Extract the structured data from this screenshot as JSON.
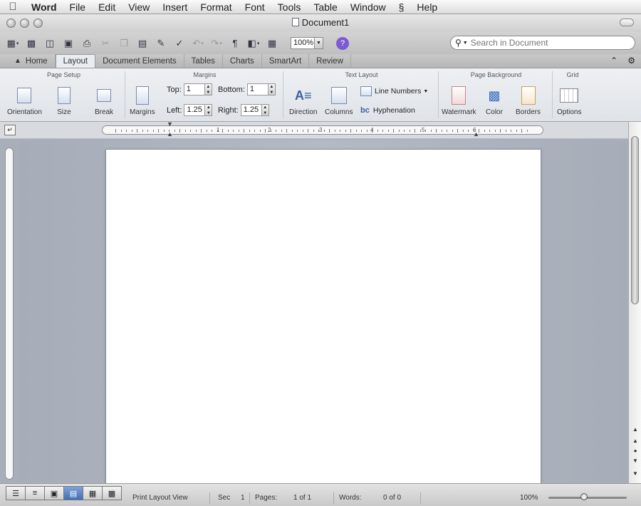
{
  "menubar": {
    "app": "Word",
    "items": [
      "File",
      "Edit",
      "View",
      "Insert",
      "Format",
      "Font",
      "Tools",
      "Table",
      "Window",
      "Help"
    ]
  },
  "window": {
    "title": "Document1"
  },
  "toolbar": {
    "zoom": "100%",
    "search_placeholder": "Search in Document"
  },
  "tabs": [
    {
      "label": "Home"
    },
    {
      "label": "Layout",
      "active": true
    },
    {
      "label": "Document Elements"
    },
    {
      "label": "Tables"
    },
    {
      "label": "Charts"
    },
    {
      "label": "SmartArt"
    },
    {
      "label": "Review"
    }
  ],
  "ribbon": {
    "page_setup": {
      "title": "Page Setup",
      "orientation": "Orientation",
      "size": "Size",
      "break": "Break"
    },
    "margins": {
      "title": "Margins",
      "button": "Margins",
      "top_label": "Top:",
      "top": "1",
      "bottom_label": "Bottom:",
      "bottom": "1",
      "left_label": "Left:",
      "left": "1.25",
      "right_label": "Right:",
      "right": "1.25"
    },
    "text_layout": {
      "title": "Text Layout",
      "direction": "Direction",
      "columns": "Columns",
      "line_numbers": "Line Numbers",
      "hyphenation": "Hyphenation"
    },
    "page_background": {
      "title": "Page Background",
      "watermark": "Watermark",
      "color": "Color",
      "borders": "Borders"
    },
    "grid": {
      "title": "Grid",
      "options": "Options"
    }
  },
  "ruler": {
    "numbers": [
      "1",
      "2",
      "3",
      "4",
      "5",
      "6"
    ]
  },
  "statusbar": {
    "view": "Print Layout View",
    "sec_label": "Sec",
    "sec": "1",
    "pages_label": "Pages:",
    "pages": "1 of 1",
    "words_label": "Words:",
    "words": "0 of 0",
    "zoom": "100%"
  },
  "colors": {
    "accent": "#3f6fb7",
    "page": "#ffffff",
    "canvas": "#a9afb9"
  }
}
